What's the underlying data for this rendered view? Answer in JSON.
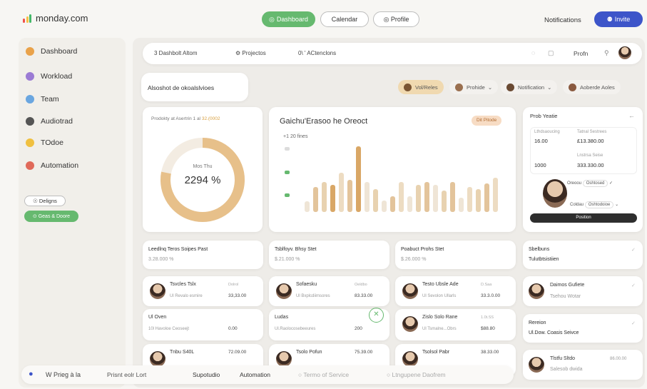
{
  "brand": {
    "name": "monday.com"
  },
  "topnav": {
    "dashboard": "Dashboard",
    "calendar": "Calendar",
    "profile": "◎ Profile",
    "notifications": "Notifications",
    "invite": "Invite"
  },
  "sidebar": {
    "items": [
      {
        "label": "Dashboard",
        "color": "#e9a24a"
      },
      {
        "label": "Workload",
        "color": "#9b7bd4"
      },
      {
        "label": "Team",
        "color": "#6aa6e0"
      },
      {
        "label": "Audiotrad",
        "color": "#555555"
      },
      {
        "label": "TOdoe",
        "color": "#f0c040"
      },
      {
        "label": "Automation",
        "color": "#e06a5a"
      }
    ],
    "designs": "☉ Deligns",
    "green_button": "⊙ Geas & Doore"
  },
  "toolbar": {
    "tab1": "Dashbolt Altom",
    "tab2": "Projectos",
    "tab3": "0\\ ' ACtenclons",
    "profile_label": "Profn"
  },
  "subheader": {
    "title": "Alsoshot de okoalslvioes",
    "chips": [
      "Vol/Reles",
      "Prohide",
      "Notification",
      "Aoberde  Aoles"
    ]
  },
  "donut": {
    "label": "Prodokty at Asertrin 1 al",
    "label_accent": "32.(0002",
    "center_small": "Mos Thu",
    "center_value": "2294 %",
    "progress": 0.78
  },
  "barchart": {
    "title": "Gaichu'Erasoo he Oreoct",
    "badge": "Dit Pitode",
    "legend": "20 fines"
  },
  "right_panel": {
    "title": "Prob Yeatie",
    "col1": "Lthdsaoucing",
    "col1b": "Tatnal Sestrees",
    "r1a": "16.00",
    "r1b": "£13.380.00",
    "col2": "Lnstrsa Seise",
    "r2a": "1000",
    "r2b": "333.330.00",
    "opt1": "Oreoou",
    "opt2": "Oshtosed",
    "opt3": "Coldau",
    "opt4": "Oshtodoioe",
    "button": "Position"
  },
  "stats": [
    {
      "title": "Leedlnq Teros Soipes Past",
      "sub": "3.28.000 %"
    },
    {
      "title": "Tsblfoyv. Bhsy Stet",
      "sub": "$.21.000 %"
    },
    {
      "title": "Poabuct Prohs Stet",
      "sub": "$.26.000 %"
    }
  ],
  "right_stats": [
    {
      "title": "Sbelbuns",
      "sub": "Tulutbtsistiien"
    },
    {
      "title": "Rereion",
      "sub": "Ul.Dow. Coasis Seivce"
    }
  ],
  "tasks_col1": [
    {
      "name": "Tsvcles Tslx",
      "sub": "Ul Revalo esmire",
      "val": "33,33.00",
      "tag": "Dolrol"
    },
    {
      "name": "Ul Oven",
      "sub": "10l Havoloe Ceoseejt",
      "val": "0.00"
    },
    {
      "name": "Tnbu S40L",
      "sub": "",
      "val": "72.09.00"
    }
  ],
  "tasks_col2": [
    {
      "name": "Sofaesku",
      "sub": "Ul Bxplcdiimsores",
      "val": "83.33.00",
      "tag": "Oeldbo"
    },
    {
      "name": "Ludas",
      "sub": "Ul.Raolocosebeeures",
      "val": "200"
    },
    {
      "name": "Tsolo Pofun",
      "sub": "",
      "val": "75.39.00"
    }
  ],
  "tasks_col3": [
    {
      "name": "Testo Ubsle Ade",
      "sub": "Ul Sevolon Ullarls",
      "val": "33.3.0.00",
      "tag": "D.Saa"
    },
    {
      "name": "Zislo Solo Rane",
      "sub": "Ul Tsmalne...Obrs",
      "val": "$88.80",
      "tag": "1.0t.SS"
    },
    {
      "name": "Tsolsol Pabr",
      "sub": "",
      "val": "38.33.00"
    }
  ],
  "right_tasks": [
    {
      "name": "Daimos Gufiete",
      "sub": "Tsehou Wotar"
    },
    {
      "name": "Tlstfu Sltdo",
      "sub": "Salesob dwida",
      "val": "86.00.00"
    }
  ],
  "footer": {
    "help": "W Prieg à la",
    "item1": "Prisnt eolr Lort",
    "item2": "Supotudio",
    "item3": "Automation",
    "item4": "Termo of Service",
    "item5": "Ltngupene Daofrem"
  },
  "colors": {
    "green": "#66b96f",
    "blue": "#3d55c9",
    "accent": "#e8c38f",
    "tan": "#d9a766"
  }
}
